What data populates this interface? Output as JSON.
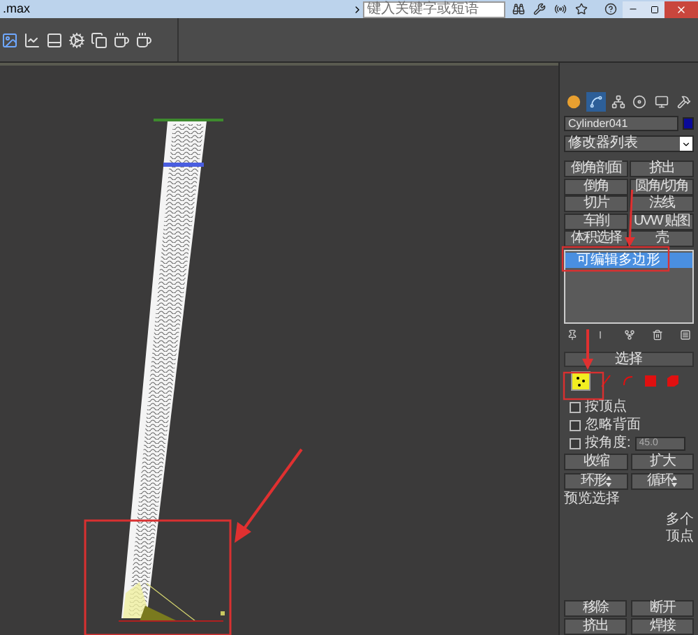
{
  "title_bar": {
    "title": ".max",
    "search": {
      "placeholder": "键入关键字或短语"
    }
  },
  "command_panel": {
    "tabs": [
      {
        "kind": "create",
        "selected": false
      },
      {
        "kind": "modify",
        "selected": true
      },
      {
        "kind": "hierarchy",
        "selected": false
      },
      {
        "kind": "motion",
        "selected": false
      },
      {
        "kind": "display",
        "selected": false
      },
      {
        "kind": "utilities",
        "selected": false
      }
    ],
    "object_name": "Cylinder041",
    "modifier_list": "修改器列表",
    "modifier_buttons": [
      "倒角剖面",
      "挤出",
      "倒角",
      "圆角/切角",
      "切片",
      "法线",
      "车削",
      "UVW 贴图",
      "体积选择",
      "壳"
    ],
    "stack": [
      {
        "label": "可编辑多边形",
        "selected": true
      }
    ],
    "selection_rollout": {
      "title": "选择",
      "levels": [
        {
          "kind": "vertex",
          "selected": true
        },
        {
          "kind": "edge",
          "selected": false
        },
        {
          "kind": "border",
          "selected": false
        },
        {
          "kind": "polygon",
          "selected": false
        },
        {
          "kind": "element",
          "selected": false
        }
      ],
      "options": [
        {
          "label": "按顶点",
          "checked": false
        },
        {
          "label": "忽略背面",
          "checked": false
        },
        {
          "label": "按角度:",
          "checked": false,
          "value": "45.0"
        }
      ],
      "buttons": [
        {
          "label": "收缩",
          "spinner": false
        },
        {
          "label": "扩大",
          "spinner": false
        },
        {
          "label": "环形",
          "spinner": true
        },
        {
          "label": "循环",
          "spinner": true
        }
      ],
      "preview_group": "预览选择",
      "preview_texts": [
        "多个",
        "顶点"
      ]
    },
    "bottom_buttons": [
      "移除",
      "断开",
      "挤出",
      "焊接"
    ]
  }
}
